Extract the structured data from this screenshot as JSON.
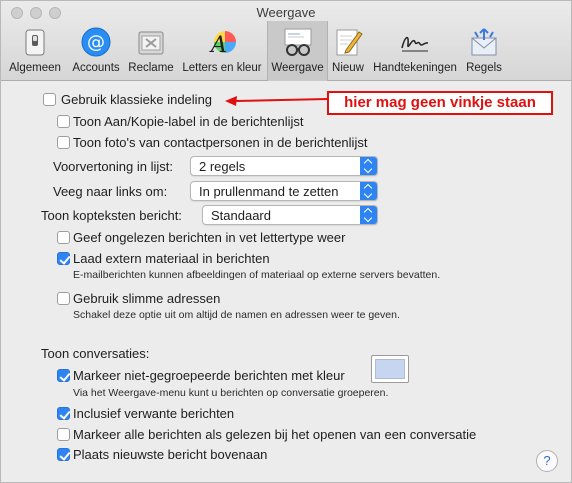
{
  "window": {
    "title": "Weergave"
  },
  "toolbar": {
    "items": [
      {
        "label": "Algemeen",
        "icon": "switch-icon"
      },
      {
        "label": "Accounts",
        "icon": "at-icon"
      },
      {
        "label": "Reclame",
        "icon": "junk-mail-icon"
      },
      {
        "label": "Letters en kleur",
        "icon": "fonts-colors-icon"
      },
      {
        "label": "Weergave",
        "icon": "viewing-glasses-icon",
        "active": true
      },
      {
        "label": "Nieuw",
        "icon": "composing-pen-icon"
      },
      {
        "label": "Handtekeningen",
        "icon": "signature-icon"
      },
      {
        "label": "Regels",
        "icon": "rules-envelope-icon"
      }
    ]
  },
  "options": {
    "classic_layout": {
      "label": "Gebruik klassieke indeling",
      "checked": false
    },
    "show_todo_label": {
      "label": "Toon Aan/Kopie-label in de berichtenlijst",
      "checked": false
    },
    "show_contact_photos": {
      "label": "Toon foto's van contactpersonen in de berichtenlijst",
      "checked": false
    },
    "preview": {
      "label": "Voorvertoning in lijst:",
      "value": "2 regels"
    },
    "swipe": {
      "label": "Veeg naar links om:",
      "value": "In prullenmand te zetten"
    },
    "headers": {
      "label": "Toon kopteksten bericht:",
      "value": "Standaard"
    },
    "bold_unread": {
      "label": "Geef ongelezen berichten in vet lettertype weer",
      "checked": false
    },
    "load_remote": {
      "label": "Laad extern materiaal in berichten",
      "checked": true,
      "note": "E-mailberichten kunnen afbeeldingen of materiaal op externe servers bevatten."
    },
    "smart_addresses": {
      "label": "Gebruik slimme adressen",
      "checked": false,
      "note": "Schakel deze optie uit om altijd de namen en adressen weer te geven."
    }
  },
  "conversations": {
    "heading": "Toon conversaties:",
    "highlight": {
      "label": "Markeer niet-gegroepeerde berichten met kleur",
      "checked": true,
      "note": "Via het Weergave-menu kunt u berichten op conversatie groeperen.",
      "color": "#c6d6f0"
    },
    "include_related": {
      "label": "Inclusief verwante berichten",
      "checked": true
    },
    "mark_all_read": {
      "label": "Markeer alle berichten als gelezen bij het openen van een conversatie",
      "checked": false
    },
    "newest_on_top": {
      "label": "Plaats nieuwste bericht bovenaan",
      "checked": true
    }
  },
  "help": {
    "label": "?"
  },
  "annotation": {
    "text": "hier mag geen vinkje staan",
    "color": "#e01010"
  },
  "accent_color": "#2f84f4"
}
